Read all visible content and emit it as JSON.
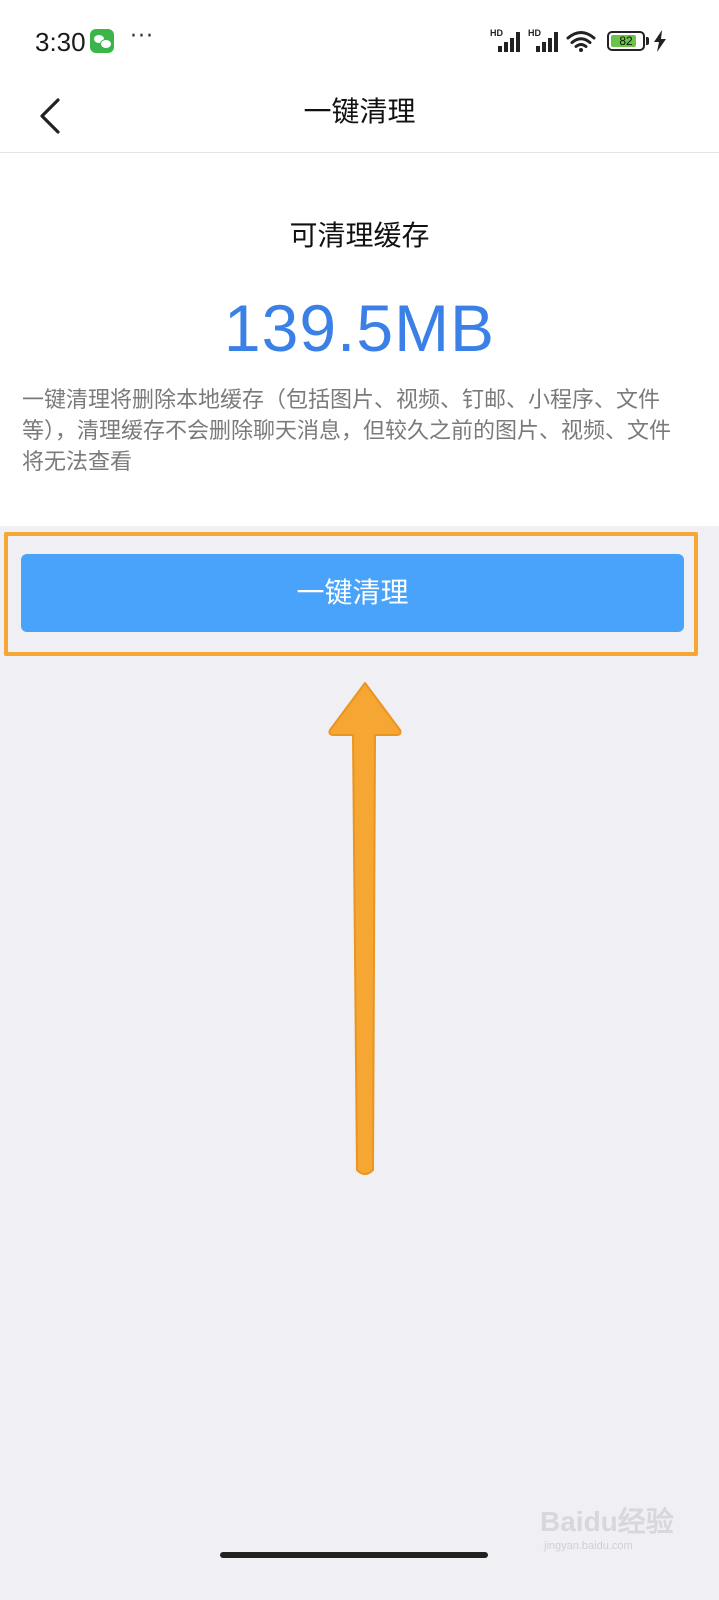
{
  "status_bar": {
    "time": "3:30",
    "more": "···",
    "signal_1_label": "HD",
    "signal_2_label": "HD",
    "battery_level": "82",
    "battery_fraction": 0.82,
    "icons": [
      "wechat-icon",
      "signal-icon",
      "wifi-icon",
      "battery-icon",
      "charging-icon"
    ]
  },
  "nav": {
    "title": "一键清理",
    "back_icon": "chevron-left-icon"
  },
  "cache": {
    "label": "可清理缓存",
    "size": "139.5MB",
    "description": "一键清理将删除本地缓存（包括图片、视频、钉邮、小程序、文件等），清理缓存不会删除聊天消息，但较久之前的图片、视频、文件将无法查看"
  },
  "action": {
    "button_label": "一键清理"
  },
  "watermark": {
    "logo": "Baidu经验",
    "url": "jingyan.baidu.com"
  },
  "colors": {
    "accent_blue": "#3a80e6",
    "button_blue": "#4aa3fa",
    "highlight_orange": "#f6a632",
    "background": "#f0eff4"
  }
}
